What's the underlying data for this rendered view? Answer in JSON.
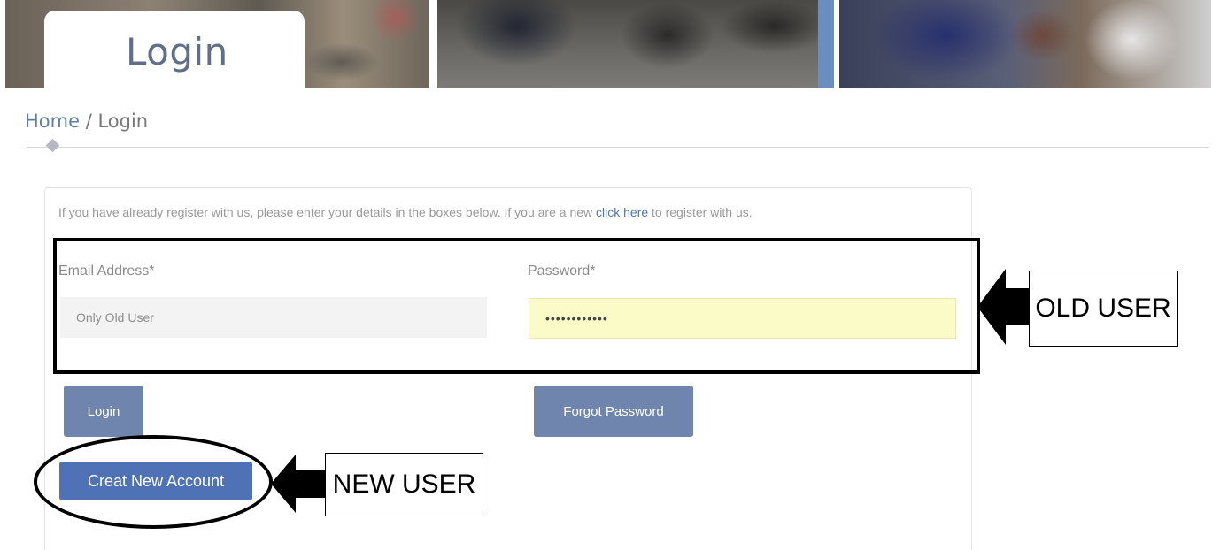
{
  "header": {
    "tab_title": "Login"
  },
  "breadcrumb": {
    "home": "Home",
    "separator": " / ",
    "current": "Login"
  },
  "intro": {
    "before_link": "If you have already register with us, please enter your details in the boxes below. If you are a new ",
    "link": "click here",
    "after_link": " to register with us."
  },
  "form": {
    "email_label": "Email Address*",
    "email_placeholder": "Only Old User",
    "email_value": "",
    "password_label": "Password*",
    "password_value": "••••••••••••"
  },
  "buttons": {
    "login": "Login",
    "forgot": "Forgot Password",
    "create": "Creat New Account"
  },
  "annotations": {
    "old_user": "OLD USER",
    "new_user": "NEW USER"
  },
  "colors": {
    "button": "#6f85ae",
    "create_button": "#4e72b5",
    "link": "#4e78b0",
    "password_bg": "#fbfbc8"
  }
}
